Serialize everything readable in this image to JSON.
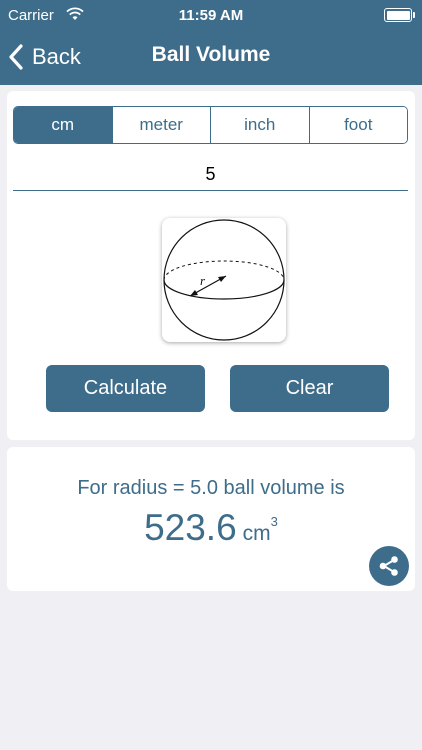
{
  "status": {
    "carrier": "Carrier",
    "time": "11:59 AM",
    "wifi_icon": "wifi-icon",
    "battery_icon": "battery-full-icon"
  },
  "nav": {
    "back_label": "Back",
    "title": "Ball Volume",
    "back_icon": "chevron-left-icon"
  },
  "units": {
    "options": [
      "cm",
      "meter",
      "inch",
      "foot"
    ],
    "selected": "cm"
  },
  "input": {
    "value": "5"
  },
  "diagram": {
    "radius_label": "r"
  },
  "buttons": {
    "calculate": "Calculate",
    "clear": "Clear"
  },
  "result": {
    "line": "For radius = 5.0 ball volume is",
    "value": "523.6",
    "unit": "cm",
    "exponent": "3"
  },
  "share_icon": "share-icon",
  "colors": {
    "accent": "#3e6d8b",
    "background": "#efeff4",
    "card": "#ffffff"
  }
}
